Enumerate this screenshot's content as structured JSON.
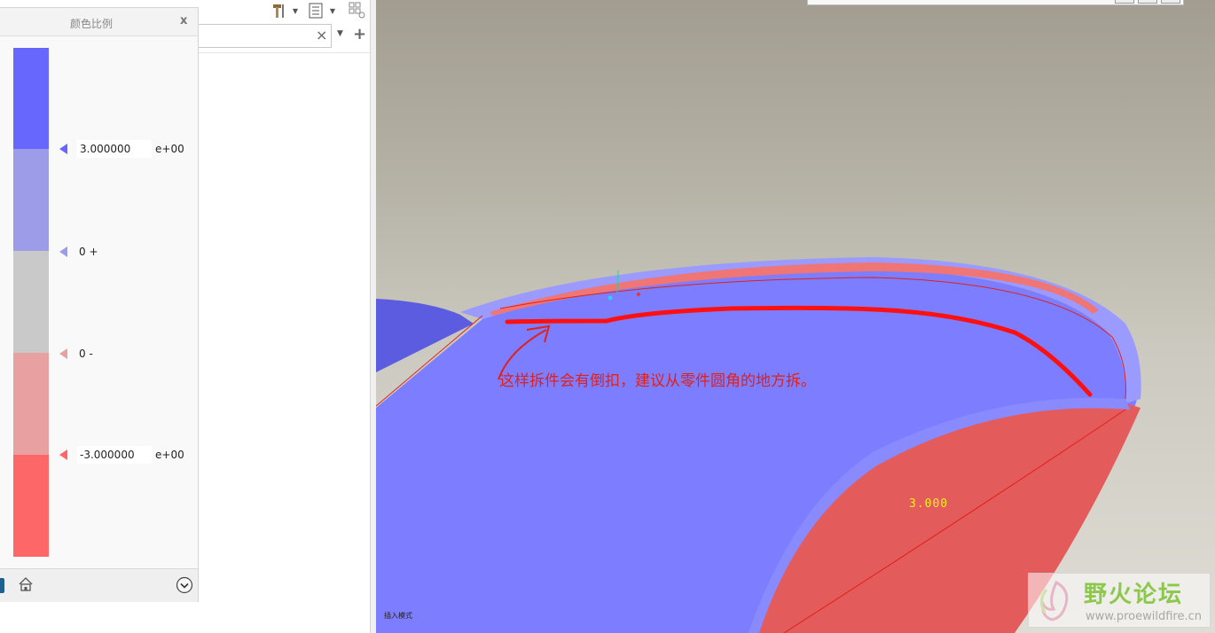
{
  "dialog": {
    "title": "颜色比例",
    "close_label": "x"
  },
  "scale": {
    "colors": [
      "#6767fe",
      "#9c9ce8",
      "#c9c9c9",
      "#e8a0a0",
      "#fe6767"
    ],
    "upper_value": "3.000000",
    "upper_exp": "e+00",
    "zero_plus": "0 +",
    "zero_minus": "0 -",
    "lower_value": "-3.000000",
    "lower_exp": "e+00"
  },
  "toolbar": {
    "tools_icon": "hammer-icon",
    "list_icon": "list-icon",
    "grid_icon": "grid-icon"
  },
  "search": {
    "clear_label": "×",
    "add_label": "+"
  },
  "viewport": {
    "annotation": "这样拆件会有倒扣，建议从零件圆角的地方拆。",
    "dimension_value": "3.000",
    "mode_label": "插入模式",
    "blue_surface": "#7d7dff",
    "red_surface": "#e45b5b",
    "annotation_color": "#e0201a"
  },
  "watermark": {
    "title": "野火论坛",
    "url": "www.proewildfire.cn"
  }
}
